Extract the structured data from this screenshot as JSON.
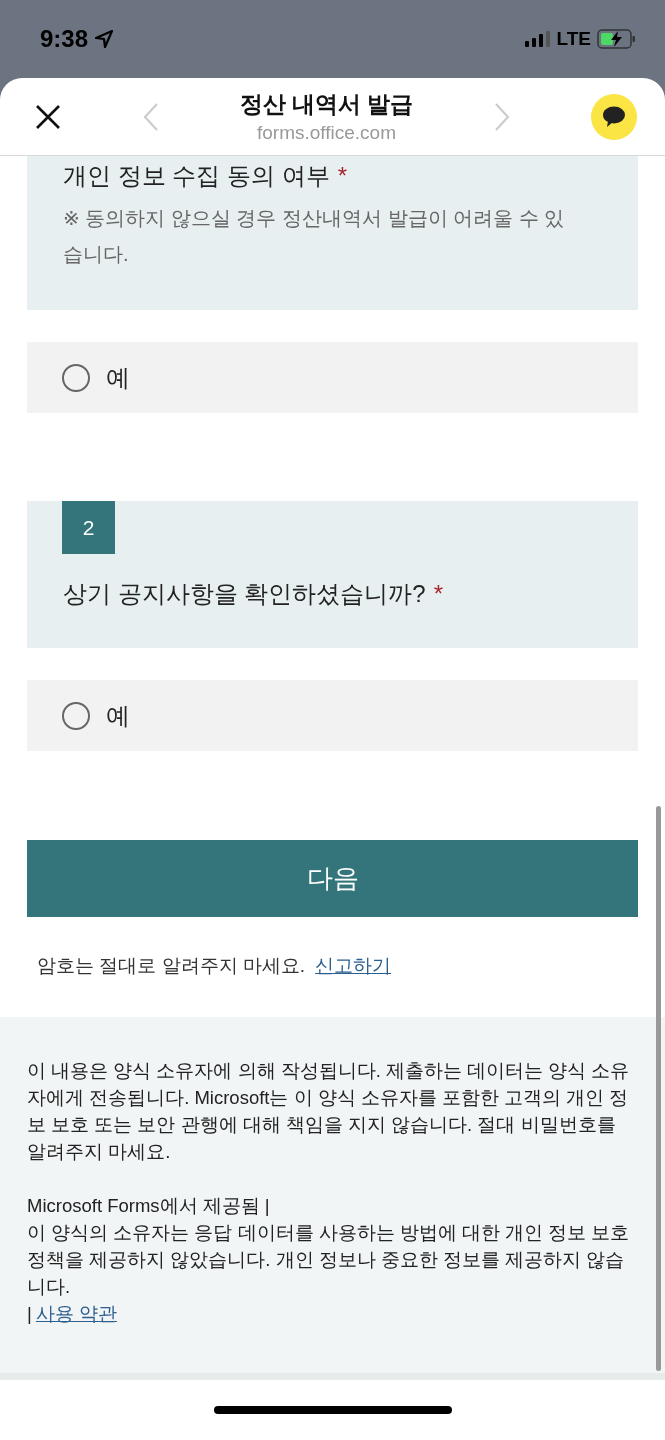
{
  "status_bar": {
    "time": "9:38",
    "network": "LTE"
  },
  "browser": {
    "title": "정산 내역서 발급",
    "url": "forms.office.com"
  },
  "questions": [
    {
      "title": "개인 정보 수집 동의 여부",
      "required_mark": "*",
      "note": "※ 동의하지 않으실 경우 정산내역서 발급이 어려울 수 있습니다.",
      "options": [
        {
          "label": "예",
          "selected": false
        }
      ]
    },
    {
      "number": "2",
      "title": "상기 공지사항을 확인하셨습니까?",
      "required_mark": "*",
      "options": [
        {
          "label": "예",
          "selected": false
        }
      ]
    }
  ],
  "next_button": "다음",
  "warning": {
    "text": "암호는 절대로 알려주지 마세요.",
    "link": "신고하기"
  },
  "footer": {
    "disclaimer": "이 내용은 양식 소유자에 의해 작성됩니다. 제출하는 데이터는 양식 소유자에게 전송됩니다. Microsoft는 이 양식 소유자를 포함한 고객의 개인 정보 보호 또는 보안 관행에 대해 책임을 지지 않습니다. 절대 비밀번호를 알려주지 마세요.",
    "provider": "Microsoft Forms에서 제공됨 |",
    "privacy": "이 양식의 소유자는 응답 데이터를 사용하는 방법에 대한 개인 정보 보호 정책을 제공하지 않았습니다. 개인 정보나 중요한 정보를 제공하지 않습니다.",
    "terms_prefix": "|",
    "terms_link": "사용 약관"
  }
}
